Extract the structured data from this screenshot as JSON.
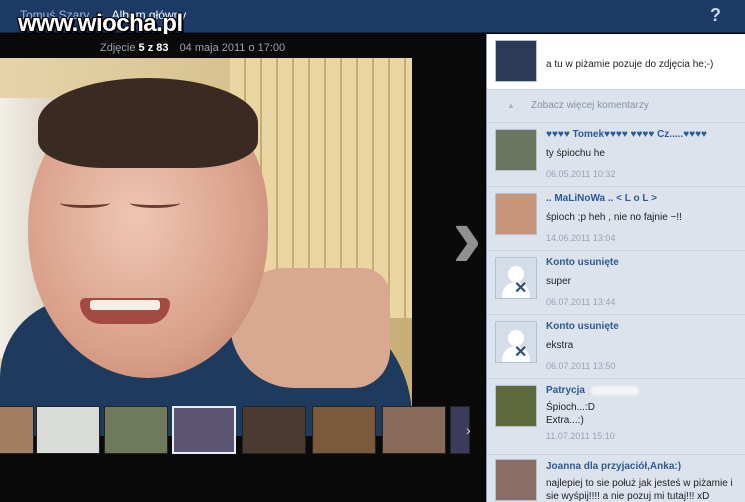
{
  "header": {
    "owner": "Tomuś Szary",
    "separator": "•",
    "album": "Album główny",
    "watermark": "www.wiocha.pl",
    "help_label": "?"
  },
  "photo_info": {
    "prefix": "Zdjęcie",
    "index_text": "5 z 83",
    "date": "04 maja 2011 o 17:00"
  },
  "viewer": {
    "next_glyph": "›",
    "strip_next_glyph": "›"
  },
  "thumbnails": [
    {
      "label": "thumb-1"
    },
    {
      "label": "thumb-2"
    },
    {
      "label": "thumb-3"
    },
    {
      "label": "thumb-4"
    },
    {
      "label": "thumb-5"
    },
    {
      "label": "thumb-6"
    },
    {
      "label": "thumb-7"
    },
    {
      "label": "thumb-8"
    }
  ],
  "comments": {
    "own": {
      "text": "a tu w piżamie pozuje do zdjęcia he;-)"
    },
    "more_label": "Zobacz więcej komentarzy",
    "items": [
      {
        "author": "♥♥♥♥ Tomek♥♥♥♥ ♥♥♥♥ Cz.....♥♥♥♥",
        "text": "ty śpiochu he",
        "time": "06.05.2011 10:32"
      },
      {
        "author": ".. MaLiNoWa .. < L o L >",
        "text": "śpioch ;p heh , nie no fajnie ~!!",
        "time": "14.06.2011 13:04"
      },
      {
        "author": "Konto usunięte",
        "text": "super",
        "time": "06.07.2011 13:44"
      },
      {
        "author": "Konto usunięte",
        "text": "ekstra",
        "time": "06.07.2011 13:50"
      },
      {
        "author": "Patrycja",
        "text": "Śpioch...:D\nExtra...:)",
        "time": "11.07.2011 15:10"
      },
      {
        "author": "Joanna dla przyjaciół,Anka:)",
        "text": "najlepiej to sie połuż jak jesteś w piżamie i sie wyśpij!!!! a nie pozuj mi tutaj!!! xD",
        "time": ""
      }
    ]
  }
}
